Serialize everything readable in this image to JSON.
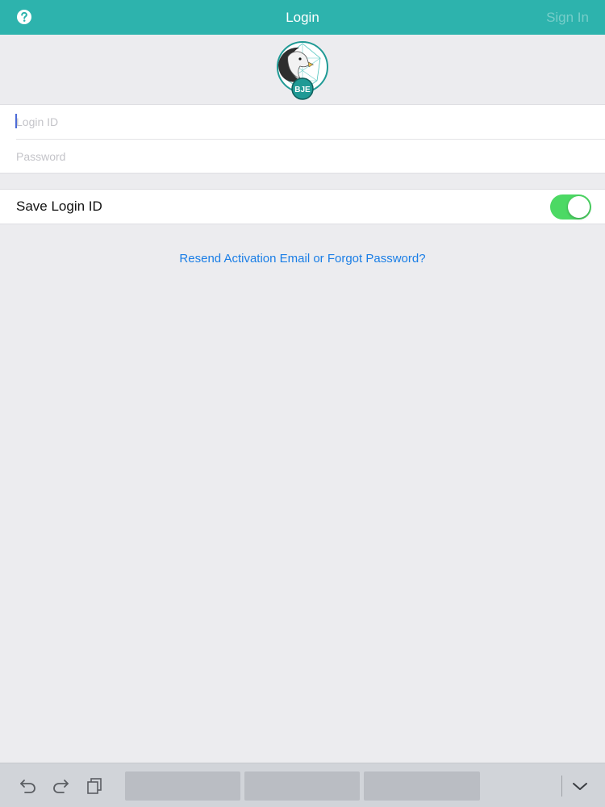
{
  "navbar": {
    "title": "Login",
    "signin_label": "Sign In",
    "help_icon": "help-circle-icon",
    "background_color": "#2db3ad"
  },
  "logo": {
    "badge_text": "BJE"
  },
  "form": {
    "login_id_placeholder": "Login ID",
    "login_id_value": "",
    "password_placeholder": "Password",
    "password_value": ""
  },
  "save_login": {
    "label": "Save Login ID",
    "enabled": true,
    "on_color": "#4cd964"
  },
  "forgot_link": "Resend Activation Email or Forgot Password?",
  "keyboard_bar": {
    "icons": [
      "undo-icon",
      "redo-icon",
      "paste-icon",
      "chevron-down-icon"
    ],
    "suggestions": [
      "",
      "",
      ""
    ]
  }
}
